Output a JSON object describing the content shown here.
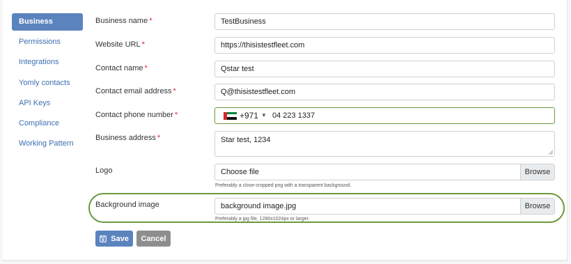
{
  "sidebar": {
    "items": [
      {
        "label": "Business",
        "active": true
      },
      {
        "label": "Permissions"
      },
      {
        "label": "Integrations"
      },
      {
        "label": "Yomly contacts"
      },
      {
        "label": "API Keys"
      },
      {
        "label": "Compliance"
      },
      {
        "label": "Working Pattern"
      }
    ]
  },
  "form": {
    "required_mark": "*",
    "business_name": {
      "label": "Business name",
      "value": "TestBusiness"
    },
    "website_url": {
      "label": "Website URL",
      "value": "https://thisistestfleet.com"
    },
    "contact_name": {
      "label": "Contact name",
      "value": "Qstar test"
    },
    "contact_email": {
      "label": "Contact email address",
      "value": "Q@thisistestfleet.com"
    },
    "contact_phone": {
      "label": "Contact phone number",
      "dial_code": "+971",
      "value": "04 223 1337",
      "flag_icon": "uae-flag-icon"
    },
    "business_address": {
      "label": "Business address",
      "value": "Star test, 1234"
    },
    "logo": {
      "label": "Logo",
      "file_text": "Choose file",
      "browse_label": "Browse",
      "hint": "Preferably a close-cropped png with a transparent background."
    },
    "background_image": {
      "label": "Background image",
      "file_text": "background image.jpg",
      "browse_label": "Browse",
      "hint": "Preferably a jpg file, 1280x1024px or larger."
    }
  },
  "actions": {
    "save_label": "Save",
    "cancel_label": "Cancel",
    "save_icon": "floppy-disk-icon"
  },
  "colors": {
    "accent": "#5b84bf",
    "highlight": "#6a9a3a",
    "required": "#d9232e",
    "cancel": "#8e8e8e"
  }
}
